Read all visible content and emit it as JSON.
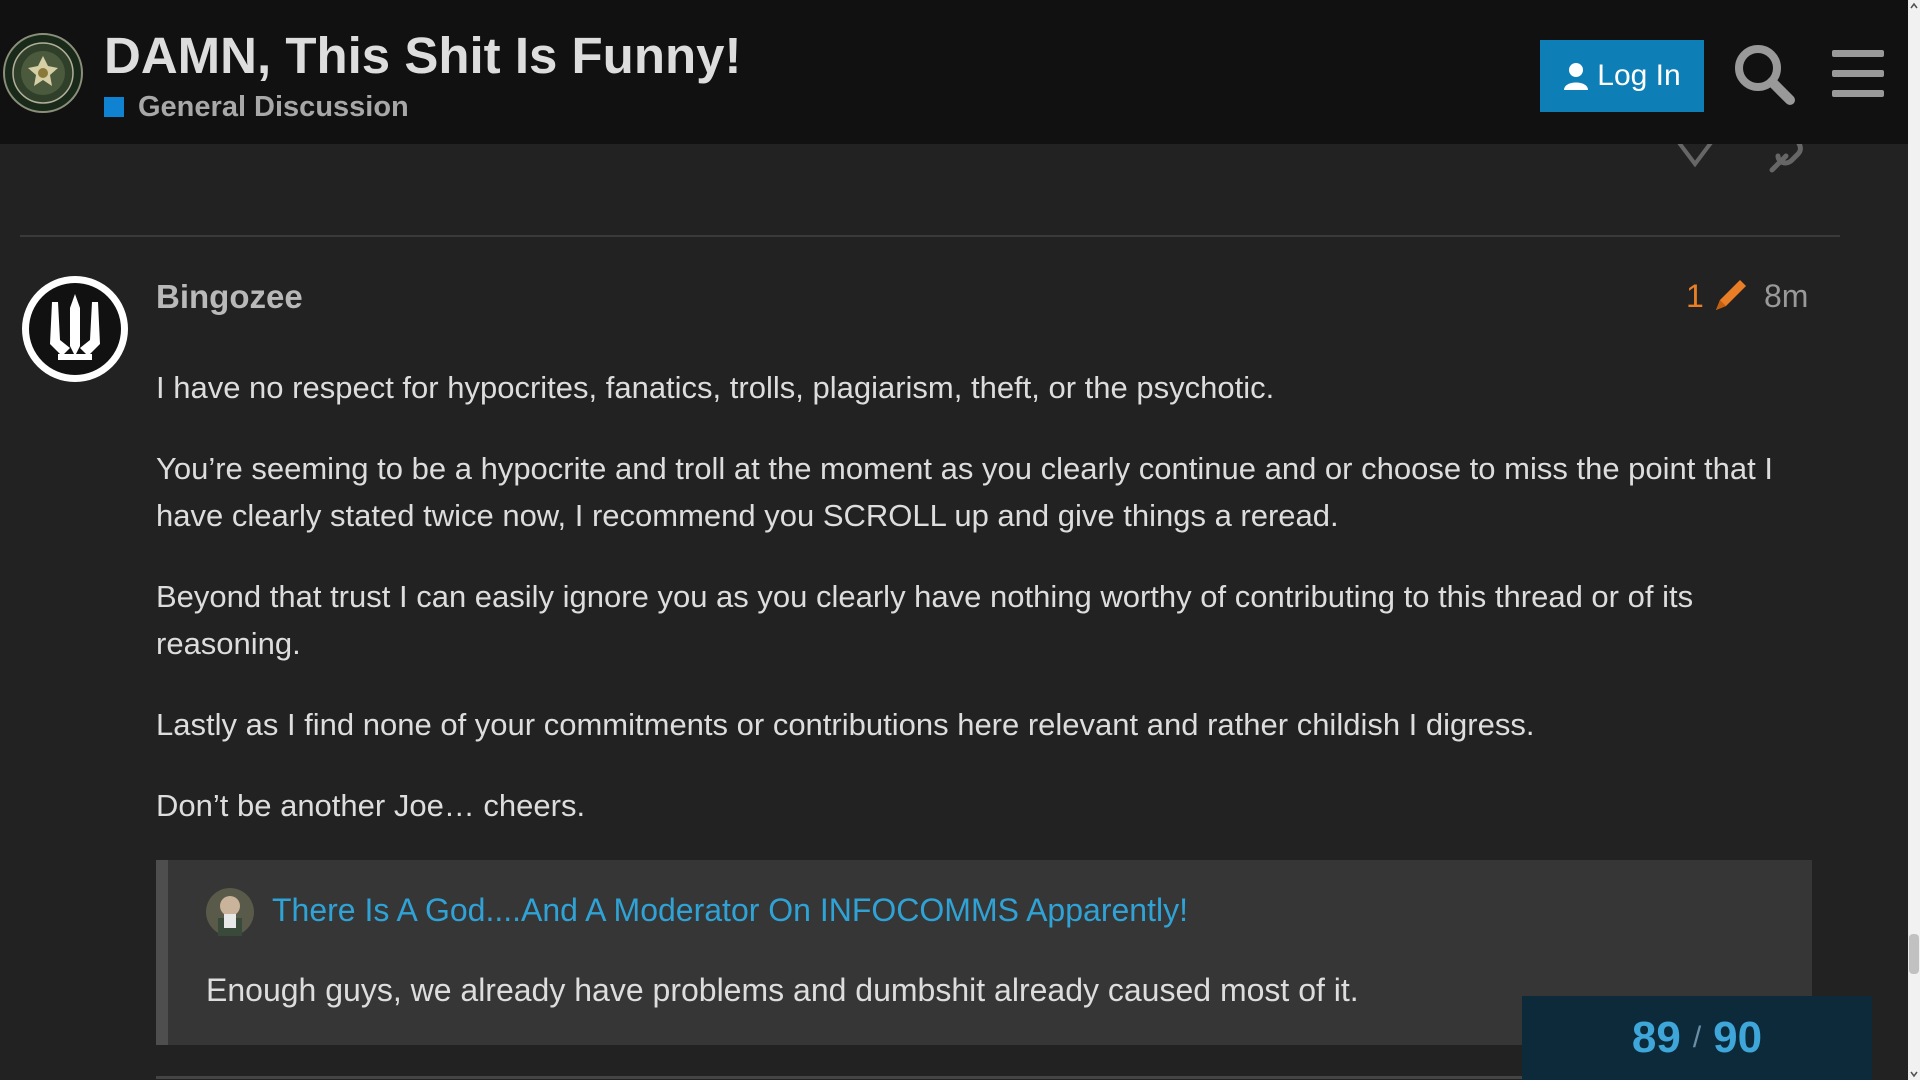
{
  "colors": {
    "header_bg": "#111111",
    "category": "#0f82d2",
    "login_button": "#0e7fb6",
    "edit_orange": "#e87e26",
    "link_blue": "#2fa2d6",
    "progress_bg": "#0d2a3a",
    "progress_text": "#3ea6d9"
  },
  "header": {
    "title": "DAMN, This Shit Is Funny!",
    "category": "General Discussion",
    "login_label": "Log In",
    "logo_icon": "infowars-army-seal-logo",
    "search_icon": "search-icon",
    "menu_icon": "hamburger-menu-icon"
  },
  "post": {
    "username": "Bingozee",
    "avatar_icon": "ukrainian-trident-avatar",
    "edit_count": "1",
    "edit_icon": "pencil-icon",
    "time": "8m",
    "paragraphs": [
      "I have no respect for hypocrites, fanatics, trolls, plagiarism, theft, or the psychotic.",
      "You’re seeming to be a hypocrite and troll at the moment as you clearly continue and or choose to miss the point that I have clearly stated twice now, I recommend you SCROLL up and give things a reread.",
      "Beyond that trust I can easily ignore you as you clearly have nothing worthy of contributing to this thread or of its reasoning.",
      "Lastly as I find none of your commitments or contributions here relevant and rather childish I digress.",
      "Don’t be another Joe… cheers."
    ],
    "quote": {
      "title": "There Is A God....And A Moderator On INFOCOMMS Apparently!",
      "text": "Enough guys, we already have problems and dumbshit already caused most of it."
    }
  },
  "progress": {
    "current": "89",
    "separator": "/",
    "total": "90"
  }
}
